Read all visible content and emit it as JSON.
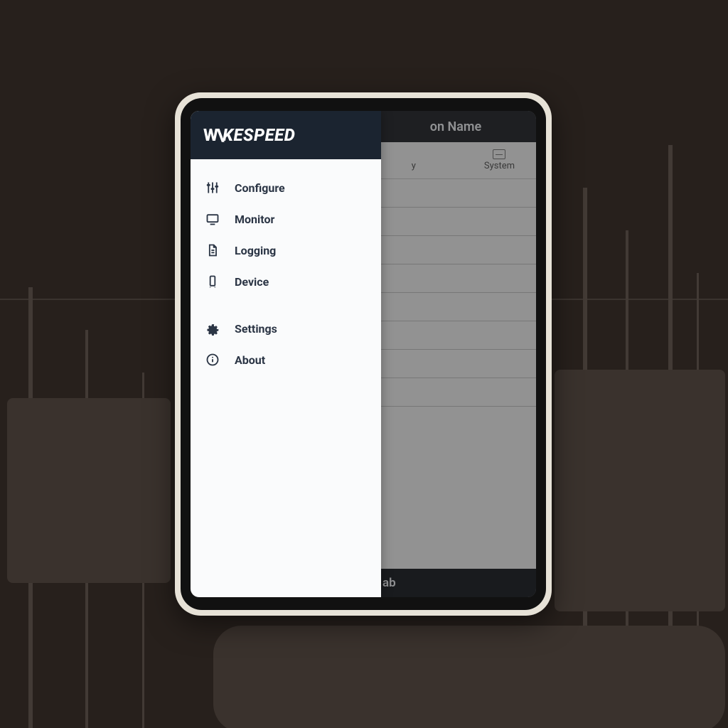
{
  "brand": {
    "name": "WAKESPEED"
  },
  "drawer": {
    "items": [
      {
        "icon": "sliders",
        "label": "Configure"
      },
      {
        "icon": "monitor",
        "label": "Monitor"
      },
      {
        "icon": "file",
        "label": "Logging"
      },
      {
        "icon": "device",
        "label": "Device"
      }
    ],
    "secondary": [
      {
        "icon": "gear",
        "label": "Settings"
      },
      {
        "icon": "info",
        "label": "About"
      }
    ]
  },
  "background_app": {
    "title_suffix": "on Name",
    "tabs": [
      {
        "label": "y"
      },
      {
        "label": "System"
      }
    ],
    "bottom_label_suffix": "ab"
  }
}
